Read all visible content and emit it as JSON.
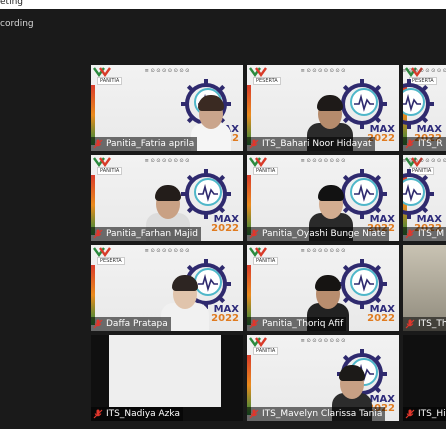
{
  "window": {
    "title_fragment": "eting",
    "status_fragment": "cording"
  },
  "slide": {
    "header": "≡ ⊙ ⊙ ⊙ ⊙ ⊙ ⊙ ⊙",
    "peserta": "PESERTA",
    "panitia": "PANITIA",
    "max_text": "MAX",
    "year": "2022"
  },
  "participants": [
    {
      "name": "Panitia_Fatria aprila",
      "muted": true
    },
    {
      "name": "ITS_Bahari Noor Hidayat",
      "muted": true
    },
    {
      "name": "ITS_R",
      "muted": true
    },
    {
      "name": "Panitia_Farhan Majid",
      "muted": true
    },
    {
      "name": "Panitia_Oyashi Bunge Niate",
      "muted": true
    },
    {
      "name": "ITS_M",
      "muted": true
    },
    {
      "name": "Daffa Pratapa",
      "muted": true
    },
    {
      "name": "Panitia_Thoriq Afif",
      "muted": true
    },
    {
      "name": "ITS_Th",
      "muted": true
    },
    {
      "name": "ITS_Nadiya Azka",
      "muted": true
    },
    {
      "name": "ITS_Mavelyn Clarissa Tania",
      "muted": true
    },
    {
      "name": "ITS_Hi",
      "muted": true
    }
  ],
  "colors": {
    "muted_mic": "#e0362c",
    "max_blue": "#2d2a7a",
    "year_orange": "#e07b20"
  }
}
